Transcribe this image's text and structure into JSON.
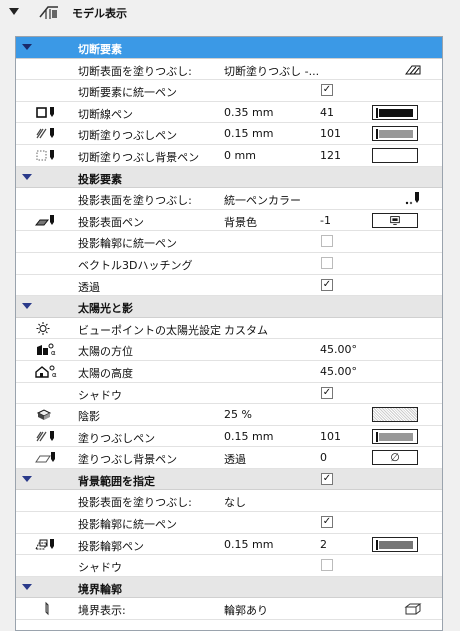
{
  "header": {
    "title": "モデル表示"
  },
  "rows": [
    {
      "type": "section",
      "label": "切断要素",
      "selected": true
    },
    {
      "type": "prop",
      "label": "切断表面を塗りつぶし:",
      "value": "切断塗りつぶし -...",
      "right_icon": "hatch-edit-icon"
    },
    {
      "type": "prop",
      "label": "切断要素に統一ペン",
      "check": true
    },
    {
      "type": "prop",
      "label": "切断線ペン",
      "icon": "cut-line-pen-icon",
      "value": "0.35 mm",
      "num": "41",
      "pen": "thick"
    },
    {
      "type": "prop",
      "label": "切断塗りつぶしペン",
      "icon": "cut-fill-pen-icon",
      "value": "0.15 mm",
      "num": "101",
      "pen": "gray"
    },
    {
      "type": "prop",
      "label": "切断塗りつぶし背景ペン",
      "icon": "cut-fill-bg-pen-icon",
      "value": "0 mm",
      "num": "121",
      "pen": "empty"
    },
    {
      "type": "section",
      "label": "投影要素"
    },
    {
      "type": "prop",
      "label": "投影表面を塗りつぶし:",
      "value": "統一ペンカラー",
      "right_icon": "pen-color-icon"
    },
    {
      "type": "prop",
      "label": "投影表面ペン",
      "icon": "projected-surface-pen-icon",
      "value": "背景色",
      "num": "-1",
      "pen": "monitor"
    },
    {
      "type": "prop",
      "label": "投影輪郭に統一ペン",
      "check": false
    },
    {
      "type": "prop",
      "label": "ベクトル3Dハッチング",
      "check": false
    },
    {
      "type": "prop",
      "label": "透過",
      "check": true
    },
    {
      "type": "section",
      "label": "太陽光と影"
    },
    {
      "type": "prop",
      "label": "ビューポイントの太陽光設定",
      "icon": "sun-icon",
      "value": "カスタム"
    },
    {
      "type": "prop",
      "label": "太陽の方位",
      "icon": "sun-azimuth-icon",
      "num": "45.00°"
    },
    {
      "type": "prop",
      "label": "太陽の高度",
      "icon": "sun-altitude-icon",
      "num": "45.00°"
    },
    {
      "type": "prop",
      "label": "シャドウ",
      "check": true
    },
    {
      "type": "prop",
      "label": "陰影",
      "icon": "shading-icon",
      "value": "25 %",
      "pen": "dotted"
    },
    {
      "type": "prop",
      "label": "塗りつぶしペン",
      "icon": "fill-pen-icon",
      "value": "0.15 mm",
      "num": "101",
      "pen": "gray"
    },
    {
      "type": "prop",
      "label": "塗りつぶし背景ペン",
      "icon": "fill-bg-pen-icon",
      "value": "透過",
      "num": "0",
      "pen": "symbol",
      "pen_symbol": "∅"
    },
    {
      "type": "section",
      "label": "背景範囲を指定",
      "check": true
    },
    {
      "type": "prop",
      "label": "投影表面を塗りつぶし:",
      "value": "なし"
    },
    {
      "type": "prop",
      "label": "投影輪郭に統一ペン",
      "check": true
    },
    {
      "type": "prop",
      "label": "投影輪郭ペン",
      "icon": "projected-contour-pen-icon",
      "value": "0.15 mm",
      "num": "2",
      "pen": "darkgray"
    },
    {
      "type": "prop",
      "label": "シャドウ",
      "check": false
    },
    {
      "type": "section",
      "label": "境界輪郭"
    },
    {
      "type": "prop",
      "label": "境界表示:",
      "icon": "boundary-icon",
      "value": "輪郭あり",
      "right_icon": "boundary-box-icon"
    }
  ]
}
